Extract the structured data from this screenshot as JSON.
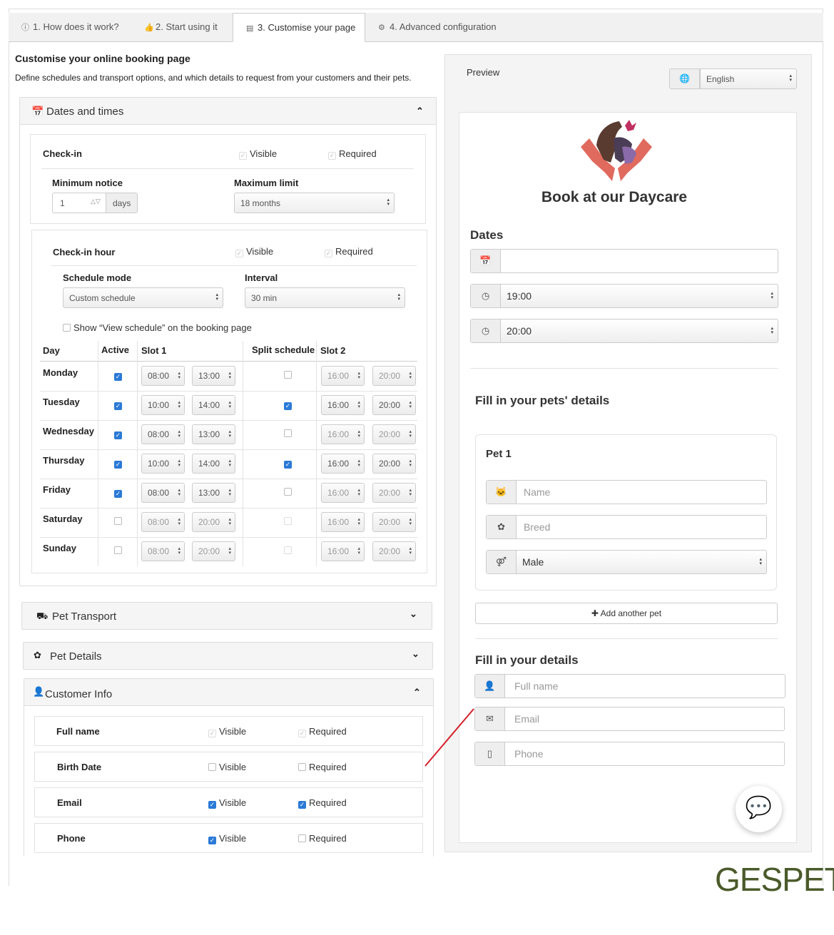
{
  "tabs": [
    {
      "icon": "info-icon",
      "label": "1. How does it work?"
    },
    {
      "icon": "thumbs-up-icon",
      "label": "2. Start using it"
    },
    {
      "icon": "page-icon",
      "label": "3. Customise your page"
    },
    {
      "icon": "gears-icon",
      "label": "4. Advanced configuration"
    }
  ],
  "intro": {
    "title": "Customise your online booking page",
    "desc": "Define schedules and transport options, and which details to request from your customers and their pets."
  },
  "dates": {
    "title": "Dates and times",
    "checkin": {
      "label": "Check-in",
      "visible": "Visible",
      "required": "Required",
      "min_label": "Minimum notice",
      "min_value": "1",
      "min_unit": "days",
      "max_label": "Maximum limit",
      "max_value": "18 months"
    },
    "hour": {
      "label": "Check-in hour",
      "visible": "Visible",
      "required": "Required",
      "mode_label": "Schedule mode",
      "mode_value": "Custom schedule",
      "interval_label": "Interval",
      "interval_value": "30 min",
      "show_schedule": "Show “View schedule” on the booking page"
    },
    "headers": {
      "day": "Day",
      "active": "Active",
      "slot1": "Slot 1",
      "split": "Split schedule",
      "slot2": "Slot 2"
    },
    "rows": [
      {
        "day": "Monday",
        "active": true,
        "s1a": "08:00",
        "s1b": "13:00",
        "split": false,
        "s2a": "16:00",
        "s2b": "20:00"
      },
      {
        "day": "Tuesday",
        "active": true,
        "s1a": "10:00",
        "s1b": "14:00",
        "split": true,
        "s2a": "16:00",
        "s2b": "20:00"
      },
      {
        "day": "Wednesday",
        "active": true,
        "s1a": "08:00",
        "s1b": "13:00",
        "split": false,
        "s2a": "16:00",
        "s2b": "20:00"
      },
      {
        "day": "Thursday",
        "active": true,
        "s1a": "10:00",
        "s1b": "14:00",
        "split": true,
        "s2a": "16:00",
        "s2b": "20:00"
      },
      {
        "day": "Friday",
        "active": true,
        "s1a": "08:00",
        "s1b": "13:00",
        "split": false,
        "s2a": "16:00",
        "s2b": "20:00"
      },
      {
        "day": "Saturday",
        "active": false,
        "s1a": "08:00",
        "s1b": "20:00",
        "split": false,
        "s2a": "16:00",
        "s2b": "20:00"
      },
      {
        "day": "Sunday",
        "active": false,
        "s1a": "08:00",
        "s1b": "20:00",
        "split": false,
        "s2a": "16:00",
        "s2b": "20:00"
      }
    ]
  },
  "transport": {
    "title": "Pet Transport"
  },
  "petdetails": {
    "title": "Pet Details"
  },
  "customer": {
    "title": "Customer Info",
    "visible": "Visible",
    "required": "Required",
    "fields": [
      {
        "label": "Full name",
        "visible": true,
        "required": true,
        "locked": true
      },
      {
        "label": "Birth Date",
        "visible": false,
        "required": false,
        "locked": false
      },
      {
        "label": "Email",
        "visible": true,
        "required": true,
        "locked": false
      },
      {
        "label": "Phone",
        "visible": true,
        "required": false,
        "locked": false
      }
    ]
  },
  "preview": {
    "title": "Preview",
    "language": "English",
    "heading": "Book at our Daycare",
    "dates_title": "Dates",
    "check_in_time": "19:00",
    "check_out_time": "20:00",
    "pets_title": "Fill in your pets' details",
    "pet1": "Pet 1",
    "name_ph": "Name",
    "breed_ph": "Breed",
    "sex": "Male",
    "add_pet": "Add another pet",
    "details_title": "Fill in your details",
    "fullname_ph": "Full name",
    "email_ph": "Email",
    "phone_ph": "Phone"
  },
  "brand": "GESPET",
  "colors": {
    "accent": "#2b7ad6",
    "logo_hands": "#e06a5e",
    "brand_text": "#4a5a2a",
    "annotation": "#d4202a"
  }
}
